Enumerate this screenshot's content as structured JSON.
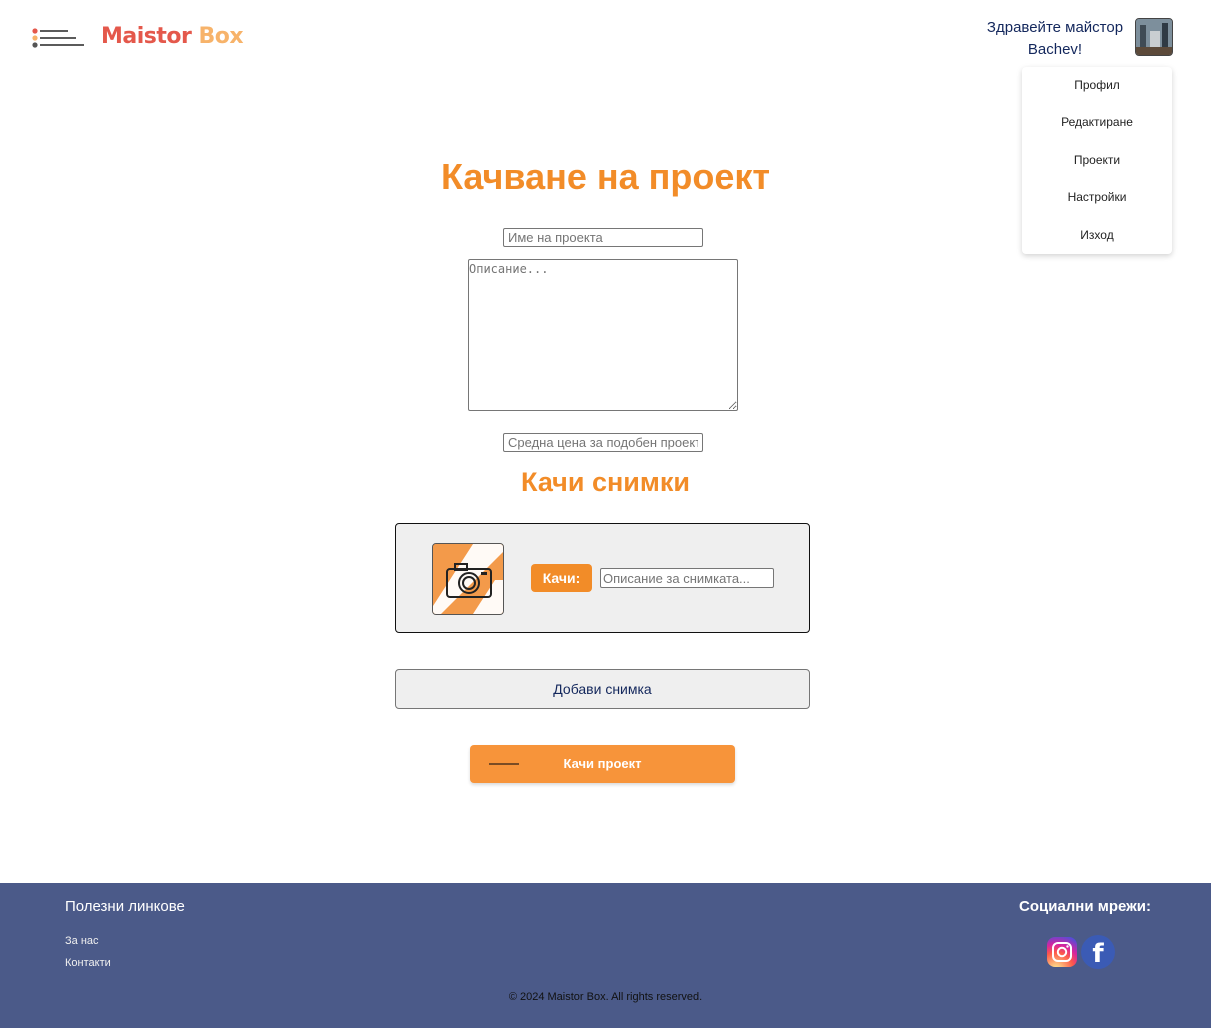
{
  "header": {
    "logo_part1": "Maistor",
    "logo_part2": "Box",
    "greeting_line1": "Здравейте майстор",
    "greeting_line2": "Bachev!",
    "menu": [
      "Профил",
      "Редактиране",
      "Проекти",
      "Настройки",
      "Изход"
    ]
  },
  "form": {
    "title": "Качване на проект",
    "name_placeholder": "Име на проекта",
    "description_placeholder": "Описание...",
    "price_placeholder": "Средна цена за подобен проект",
    "photos_title": "Качи снимки",
    "upload_label": "Качи:",
    "photo_desc_placeholder": "Описание за снимката...",
    "add_photo_label": "Добави снимка",
    "submit_label": "Качи проект"
  },
  "footer": {
    "links_title": "Полезни линкове",
    "links": [
      "За нас",
      "Контакти"
    ],
    "social_title": "Социални мрежи:",
    "copyright": "© 2024 Maistor Box. All rights reserved."
  },
  "colors": {
    "accent": "#f28c28",
    "footer_bg": "#4b5a89",
    "logo_red": "#e4584b",
    "logo_orange": "#f7b36a"
  }
}
